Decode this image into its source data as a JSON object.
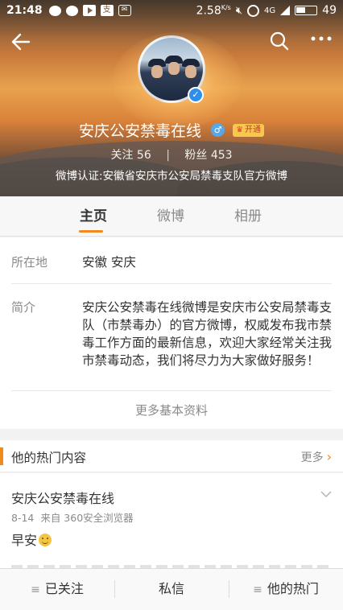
{
  "status_bar": {
    "time": "21:48",
    "speed": "2.58",
    "speed_unit": "K/s",
    "network": "4G",
    "battery": "49",
    "battery_level": 0.49
  },
  "header": {
    "username": "安庆公安禁毒在线",
    "gender_symbol": "♂",
    "vip_label": "开通",
    "following_label": "关注",
    "following_count": "56",
    "fans_label": "粉丝",
    "fans_count": "453",
    "verification": "微博认证:安徽省安庆市公安局禁毒支队官方微博"
  },
  "tabs": [
    {
      "label": "主页",
      "active": true
    },
    {
      "label": "微博",
      "active": false
    },
    {
      "label": "相册",
      "active": false
    }
  ],
  "info": {
    "location_label": "所在地",
    "location_value": "安徽 安庆",
    "intro_label": "简介",
    "intro_value": "安庆公安禁毒在线微博是安庆市公安局禁毒支队（市禁毒办）的官方微博，权威发布我市禁毒工作方面的最新信息，欢迎大家经常关注我市禁毒动态，我们将尽力为大家做好服务！",
    "more_label": "更多基本资料"
  },
  "hot": {
    "title": "他的热门内容",
    "more_label": "更多"
  },
  "post": {
    "author": "安庆公安禁毒在线",
    "date": "8-14",
    "source": "来自 360安全浏览器",
    "text": "早安"
  },
  "bottom_bar": {
    "followed": "已关注",
    "message": "私信",
    "hot": "他的热门"
  },
  "colors": {
    "accent": "#f08a1c",
    "verified": "#2f8fe8"
  }
}
